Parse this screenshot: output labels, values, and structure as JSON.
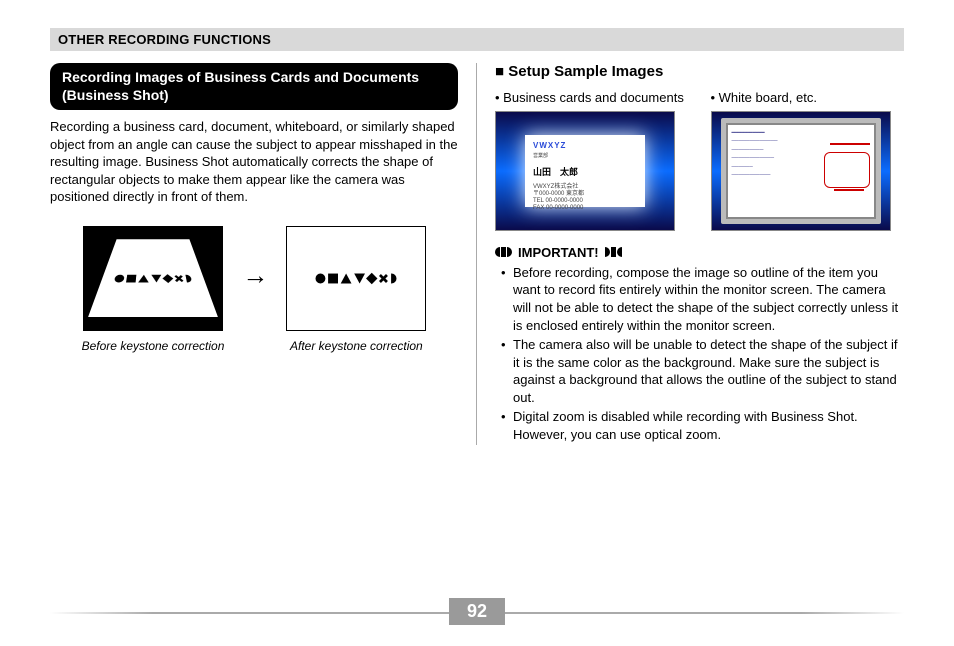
{
  "header": "OTHER RECORDING FUNCTIONS",
  "left": {
    "title": "Recording Images of Business Cards and Documents (Business Shot)",
    "body": "Recording a business card, document, whiteboard, or similarly shaped object from an angle can cause the subject to appear misshaped in the resulting image. Business Shot automatically corrects the shape of rectangular objects to make them appear like the camera was positioned directly in front of them.",
    "caption_before": "Before keystone correction",
    "caption_after": "After keystone correction"
  },
  "right": {
    "heading": "■ Setup Sample Images",
    "sample1_label": "• Business cards and documents",
    "sample2_label": "• White board, etc.",
    "bizcard_logo": "VWXYZ",
    "bizcard_name": "山田　太郎",
    "important": "IMPORTANT!",
    "bullets": [
      "Before recording, compose the image so outline of the item you want to record fits entirely within the monitor screen. The camera will not be able to detect the shape of the subject correctly unless it is enclosed entirely within the monitor screen.",
      "The camera also will be unable to detect the shape of the subject if it is the same color as the background. Make sure the subject is against a background that allows the outline of the subject to stand out.",
      "Digital zoom is disabled while recording with Business Shot. However, you can use optical zoom."
    ]
  },
  "page_number": "92"
}
